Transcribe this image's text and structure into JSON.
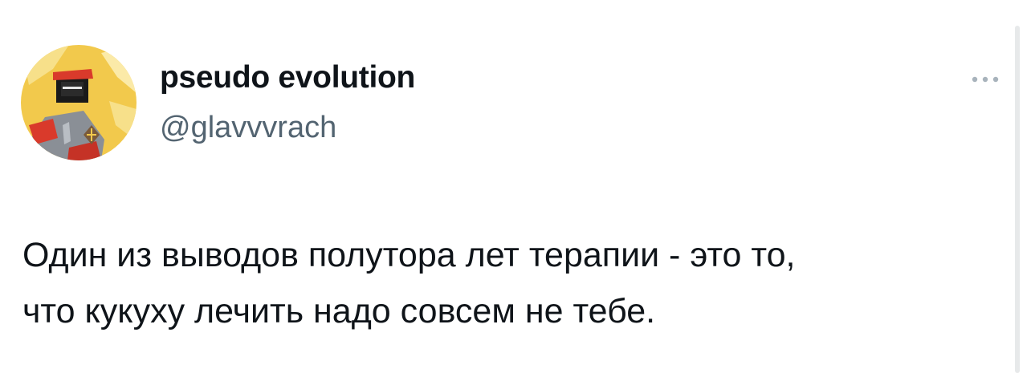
{
  "author": {
    "display_name": "pseudo evolution",
    "handle": "@glavvvrach",
    "avatar_icon": "avatar-image"
  },
  "actions": {
    "more_icon": "more-horizontal-icon"
  },
  "tweet": {
    "line1": "Один из выводов полутора лет терапии - это то,",
    "line2": "что кукуху лечить надо совсем не тебе."
  },
  "colors": {
    "text_primary": "#0f1419",
    "text_secondary": "#536471",
    "avatar_bg": "#f2c94c",
    "avatar_accent": "#d93a2b"
  }
}
